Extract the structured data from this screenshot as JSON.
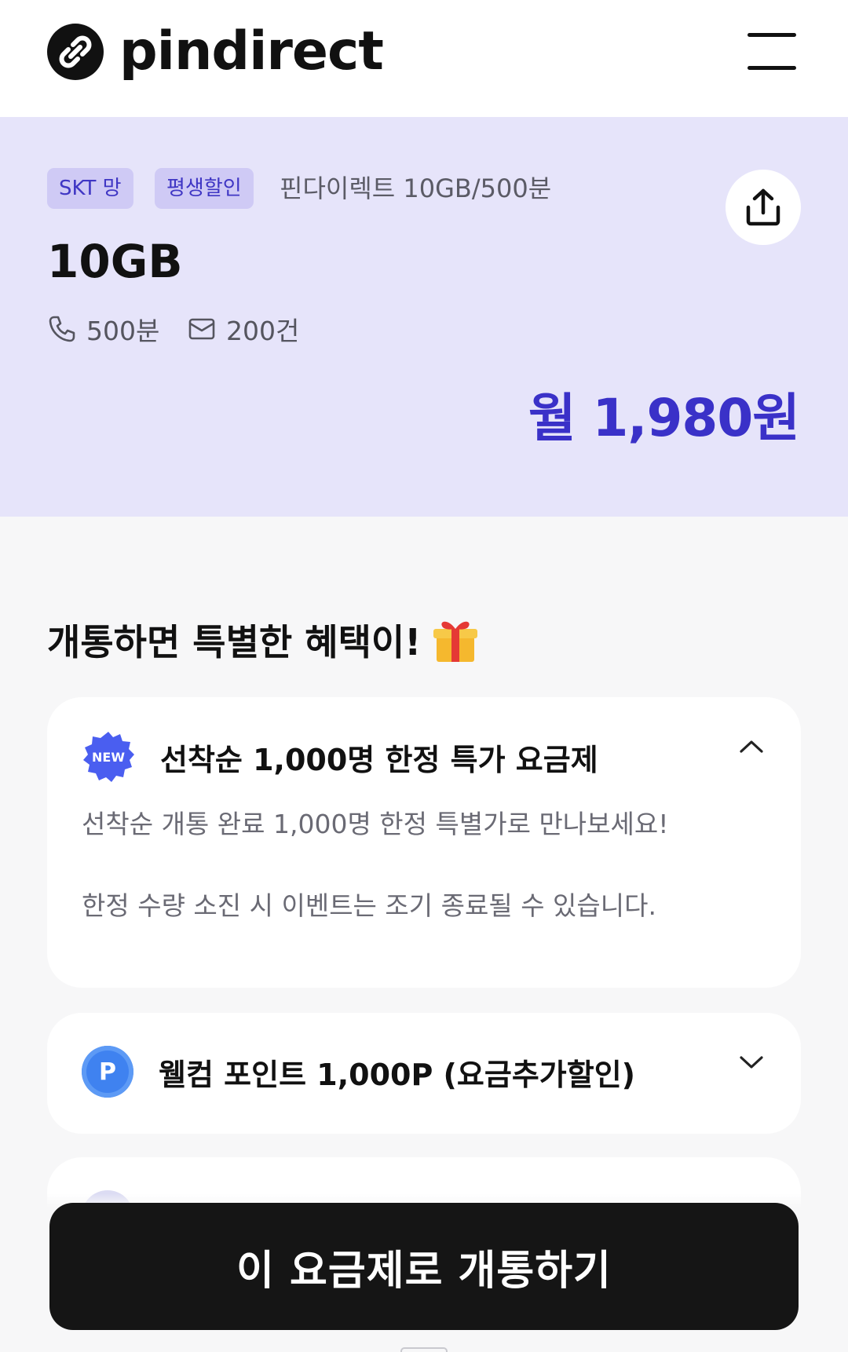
{
  "header": {
    "logo_text": "pindirect",
    "logo_icon": "link-icon",
    "menu_icon": "hamburger-menu-icon"
  },
  "plan": {
    "chips": [
      "SKT 망",
      "평생할인"
    ],
    "name": "핀다이렉트 10GB/500분",
    "data": "10GB",
    "call": "500분",
    "message": "200건",
    "price": "월 1,980원",
    "share_icon": "share-icon"
  },
  "benefits": {
    "title": "개통하면 특별한 혜택이!",
    "cards": [
      {
        "title": "선착순 1,000명 한정 특가 요금제",
        "icon": "new-badge-icon",
        "badge_text": "NEW",
        "expanded": true,
        "lines": [
          "선착순 개통 완료 1,000명 한정 특별가로 만나보세요!",
          "한정 수량 소진 시 이벤트는 조기 종료될 수 있습니다."
        ]
      },
      {
        "title": "웰컴 포인트 1,000P (요금추가할인)",
        "icon": "point-icon",
        "badge_text": "P",
        "expanded": false
      }
    ]
  },
  "cta": {
    "label": "이 요금제로 개통하기"
  },
  "colors": {
    "accent": "#3a31c8",
    "plan_bg": "#e6e4fa",
    "chip_bg": "#cfcaf5",
    "cta_bg": "#151515"
  }
}
